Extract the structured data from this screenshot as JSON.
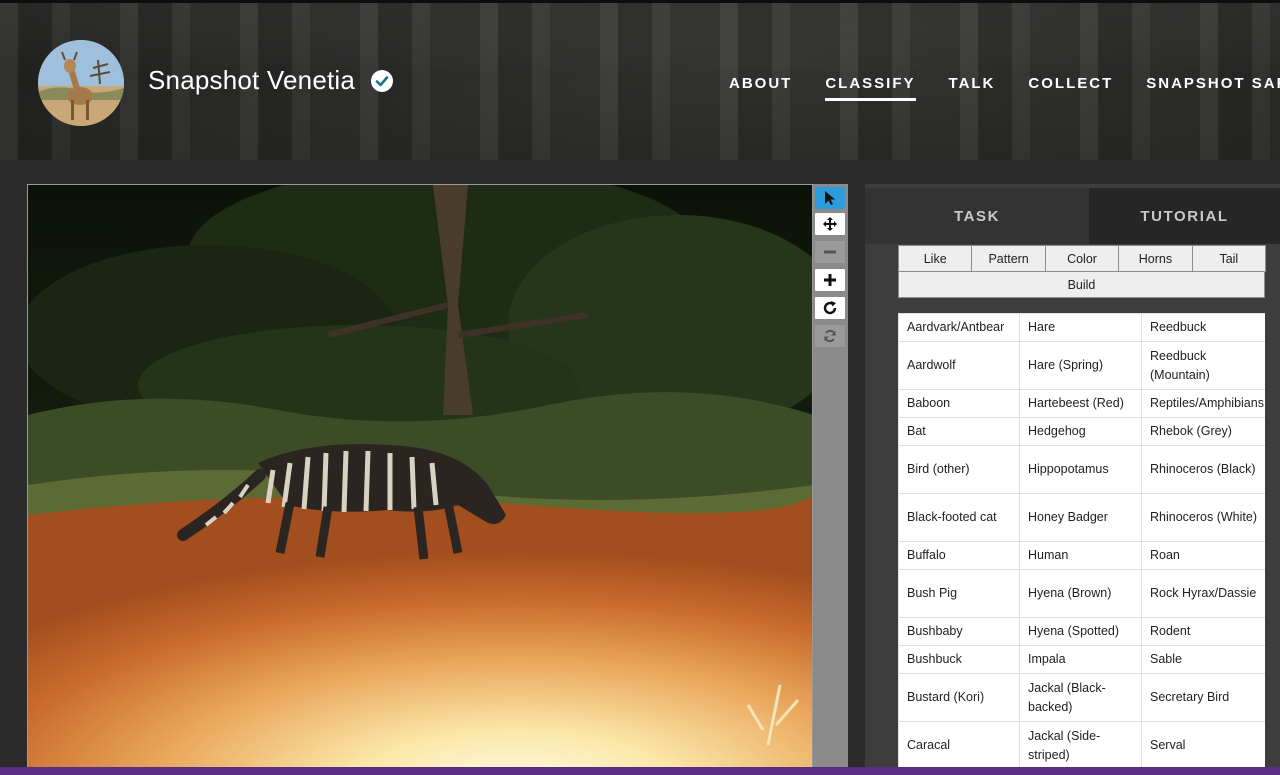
{
  "header": {
    "title": "Snapshot Venetia",
    "nav": [
      {
        "label": "ABOUT",
        "active": false
      },
      {
        "label": "CLASSIFY",
        "active": true
      },
      {
        "label": "TALK",
        "active": false
      },
      {
        "label": "COLLECT",
        "active": false
      },
      {
        "label": "SNAPSHOT SAFARI",
        "active": false
      }
    ]
  },
  "viewer": {
    "tools": [
      {
        "name": "select-tool-button",
        "icon": "pointer-arrow-icon",
        "state": "active"
      },
      {
        "name": "move-tool-button",
        "icon": "move-arrows-icon",
        "state": "normal"
      },
      {
        "name": "zoom-out-button",
        "icon": "minus-icon",
        "state": "disabled"
      },
      {
        "name": "zoom-in-button",
        "icon": "plus-icon",
        "state": "normal"
      },
      {
        "name": "rotate-button",
        "icon": "rotate-icon",
        "state": "normal"
      },
      {
        "name": "reset-view-button",
        "icon": "refresh-icon",
        "state": "disabled"
      }
    ]
  },
  "panel": {
    "tabs": {
      "task": "TASK",
      "tutorial": "TUTORIAL"
    },
    "filters": [
      "Like",
      "Pattern",
      "Color",
      "Horns",
      "Tail"
    ],
    "filter_build": "Build",
    "species_rows": [
      [
        "Aardvark/Antbear",
        "Hare",
        "Reedbuck"
      ],
      [
        "Aardwolf",
        "Hare (Spring)",
        "Reedbuck (Mountain)"
      ],
      [
        "Baboon",
        "Hartebeest (Red)",
        "Reptiles/Amphibians"
      ],
      [
        "Bat",
        "Hedgehog",
        "Rhebok (Grey)"
      ],
      [
        "Bird (other)",
        "Hippopotamus",
        "Rhinoceros (Black)"
      ],
      [
        "Black-footed cat",
        "Honey Badger",
        "Rhinoceros (White)"
      ],
      [
        "Buffalo",
        "Human",
        "Roan"
      ],
      [
        "Bush Pig",
        "Hyena (Brown)",
        "Rock Hyrax/Dassie"
      ],
      [
        "Bushbaby",
        "Hyena (Spotted)",
        "Rodent"
      ],
      [
        "Bushbuck",
        "Impala",
        "Sable"
      ],
      [
        "Bustard (Kori)",
        "Jackal (Black-backed)",
        "Secretary Bird"
      ],
      [
        "Caracal",
        "Jackal (Side-striped)",
        "Serval"
      ]
    ]
  },
  "colors": {
    "accent_blue": "#2d9cdb",
    "panel_bg": "#3d3d3d",
    "footer_purple": "#5a2d82"
  }
}
